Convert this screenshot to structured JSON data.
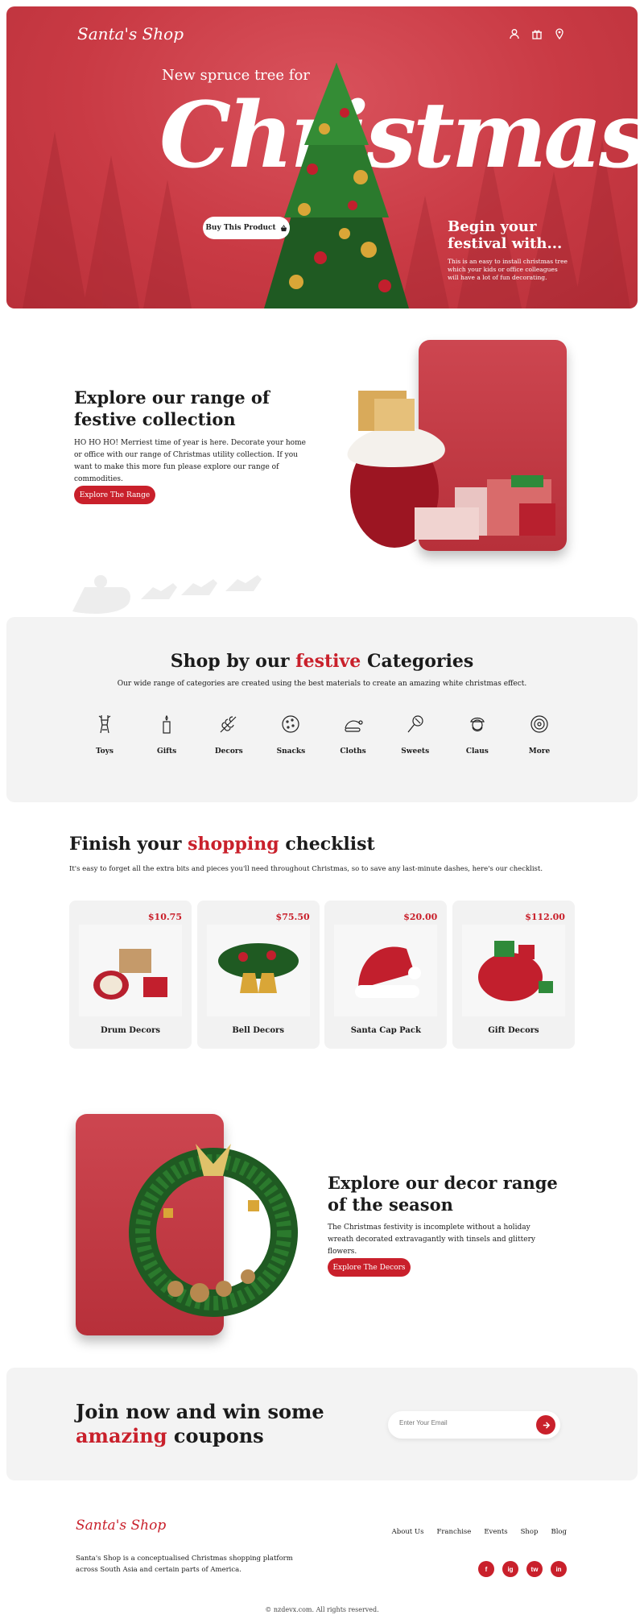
{
  "header": {
    "logo": "Santa's Shop",
    "icons": [
      "user-icon",
      "gift-icon",
      "location-icon"
    ]
  },
  "hero": {
    "pre_title": "New spruce tree for",
    "title": "Christmas",
    "buy_button": "Buy This Product",
    "begin_heading": "Begin your festival with...",
    "begin_text": "This is an easy to install christmas tree which your kids or office colleagues will have a lot of fun decorating."
  },
  "explore": {
    "title": "Explore our range of festive collection",
    "text": "HO HO HO! Merriest time of year is here. Decorate your home or office with our range of Christmas utility collection. If you want to make this more fun please explore our range of commodities.",
    "button": "Explore The Range"
  },
  "categories": {
    "title_before": "Shop by our",
    "title_highlight": "festive",
    "title_after": "Categories",
    "subtitle": "Our wide range of categories are created using the best materials to create an amazing white christmas effect.",
    "items": [
      {
        "label": "Toys",
        "icon": "reindeer-icon"
      },
      {
        "label": "Gifts",
        "icon": "candle-icon"
      },
      {
        "label": "Decors",
        "icon": "leaf-icon"
      },
      {
        "label": "Snacks",
        "icon": "cookie-icon"
      },
      {
        "label": "Cloths",
        "icon": "hat-icon"
      },
      {
        "label": "Sweets",
        "icon": "lollipop-icon"
      },
      {
        "label": "Claus",
        "icon": "santa-icon"
      },
      {
        "label": "More",
        "icon": "more-icon"
      }
    ]
  },
  "checklist": {
    "title_before": "Finish your",
    "title_highlight": "shopping",
    "title_after": "checklist",
    "text": "It's easy to forget all the extra bits and pieces you'll need throughout Christmas, so to save any last-minute dashes, here's our checklist.",
    "products": [
      {
        "name": "Drum Decors",
        "price": "$10.75"
      },
      {
        "name": "Bell Decors",
        "price": "$75.50"
      },
      {
        "name": "Santa Cap Pack",
        "price": "$20.00"
      },
      {
        "name": "Gift Decors",
        "price": "$112.00"
      }
    ]
  },
  "decor": {
    "title": "Explore our decor range of the season",
    "text": "The Christmas festivity is incomplete without a holiday wreath decorated extravagantly with tinsels and glittery flowers.",
    "button": "Explore The Decors"
  },
  "join": {
    "title_line1": "Join now and win some",
    "title_highlight": "amazing",
    "title_after": "coupons",
    "placeholder": "Enter Your Email"
  },
  "footer": {
    "logo": "Santa's Shop",
    "description": "Santa's Shop is a conceptualised Christmas shopping platform across South Asia and certain parts of America.",
    "nav": [
      "About Us",
      "Franchise",
      "Events",
      "Shop",
      "Blog"
    ],
    "social": [
      "f",
      "ig",
      "tw",
      "in"
    ],
    "copyright": "© nzdevx.com. All rights reserved."
  },
  "colors": {
    "accent": "#c9202b",
    "hero": "#c93a44",
    "panel": "#f3f3f3"
  }
}
